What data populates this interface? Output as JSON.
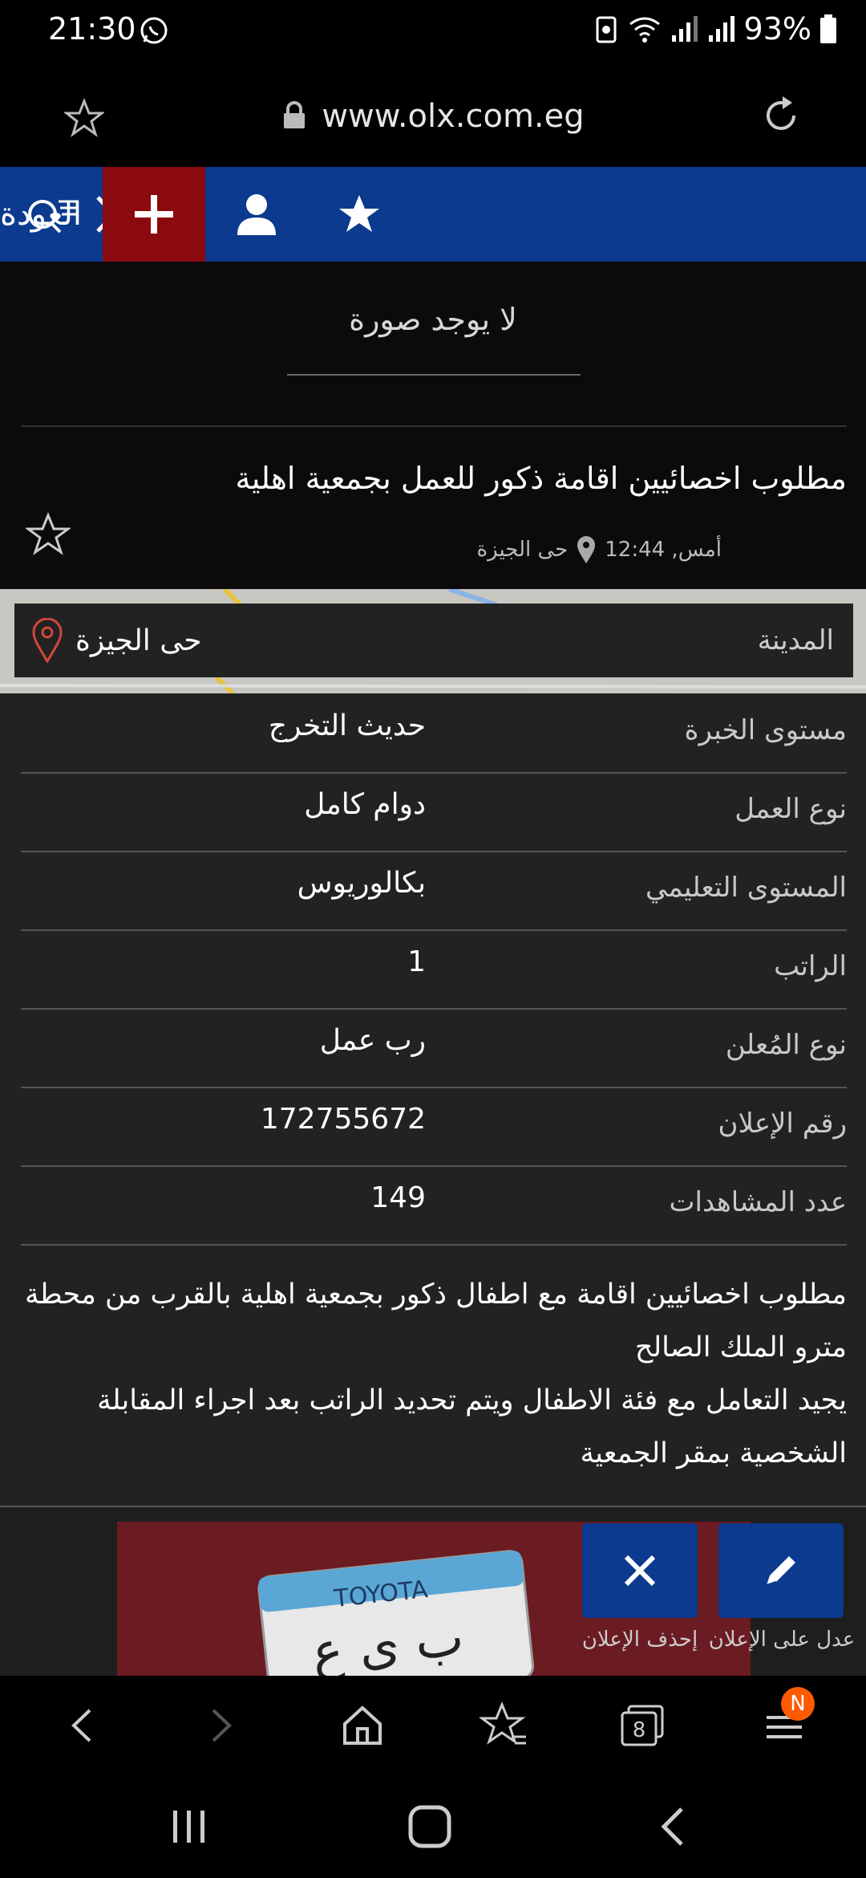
{
  "status": {
    "time": "21:30",
    "battery": "93%"
  },
  "browser": {
    "url": "www.olx.com.eg"
  },
  "nav": {
    "back_label": "العودة"
  },
  "listing": {
    "no_image_text": "لا يوجد صورة",
    "title": "مطلوب اخصائيين اقامة ذكور للعمل بجمعية اهلية",
    "time": "أمس, 12:44",
    "location": "حى الجيزة"
  },
  "city": {
    "label": "المدينة",
    "value": "حى الجيزة"
  },
  "details": [
    {
      "label": "مستوى الخبرة",
      "value": "حديث التخرج"
    },
    {
      "label": "نوع العمل",
      "value": "دوام كامل"
    },
    {
      "label": "المستوى التعليمي",
      "value": "بكالوريوس"
    },
    {
      "label": "الراتب",
      "value": "1"
    },
    {
      "label": "نوع المُعلن",
      "value": "رب عمل"
    },
    {
      "label": "رقم الإعلان",
      "value": "172755672"
    },
    {
      "label": "عدد المشاهدات",
      "value": "149"
    }
  ],
  "description": {
    "line1": "مطلوب اخصائيين اقامة مع اطفال ذكور بجمعية اهلية بالقرب من محطة",
    "line2": "مترو الملك الصالح",
    "line3": "يجيد التعامل مع فئة الاطفال ويتم تحديد الراتب بعد اجراء المقابلة",
    "line4": "الشخصية بمقر الجمعية"
  },
  "actions": {
    "edit_label": "عدل على الإعلان",
    "delete_label": "إحذف الإعلان"
  },
  "ad_banner": {
    "brand": "TOYOTA",
    "plate": "ب ى ع"
  },
  "browser_bar": {
    "tabs_count": "8",
    "badge": "N"
  },
  "colors": {
    "nav_blue": "#0b3a8f",
    "add_red": "#8b0a10",
    "badge_orange": "#ff5a00"
  }
}
